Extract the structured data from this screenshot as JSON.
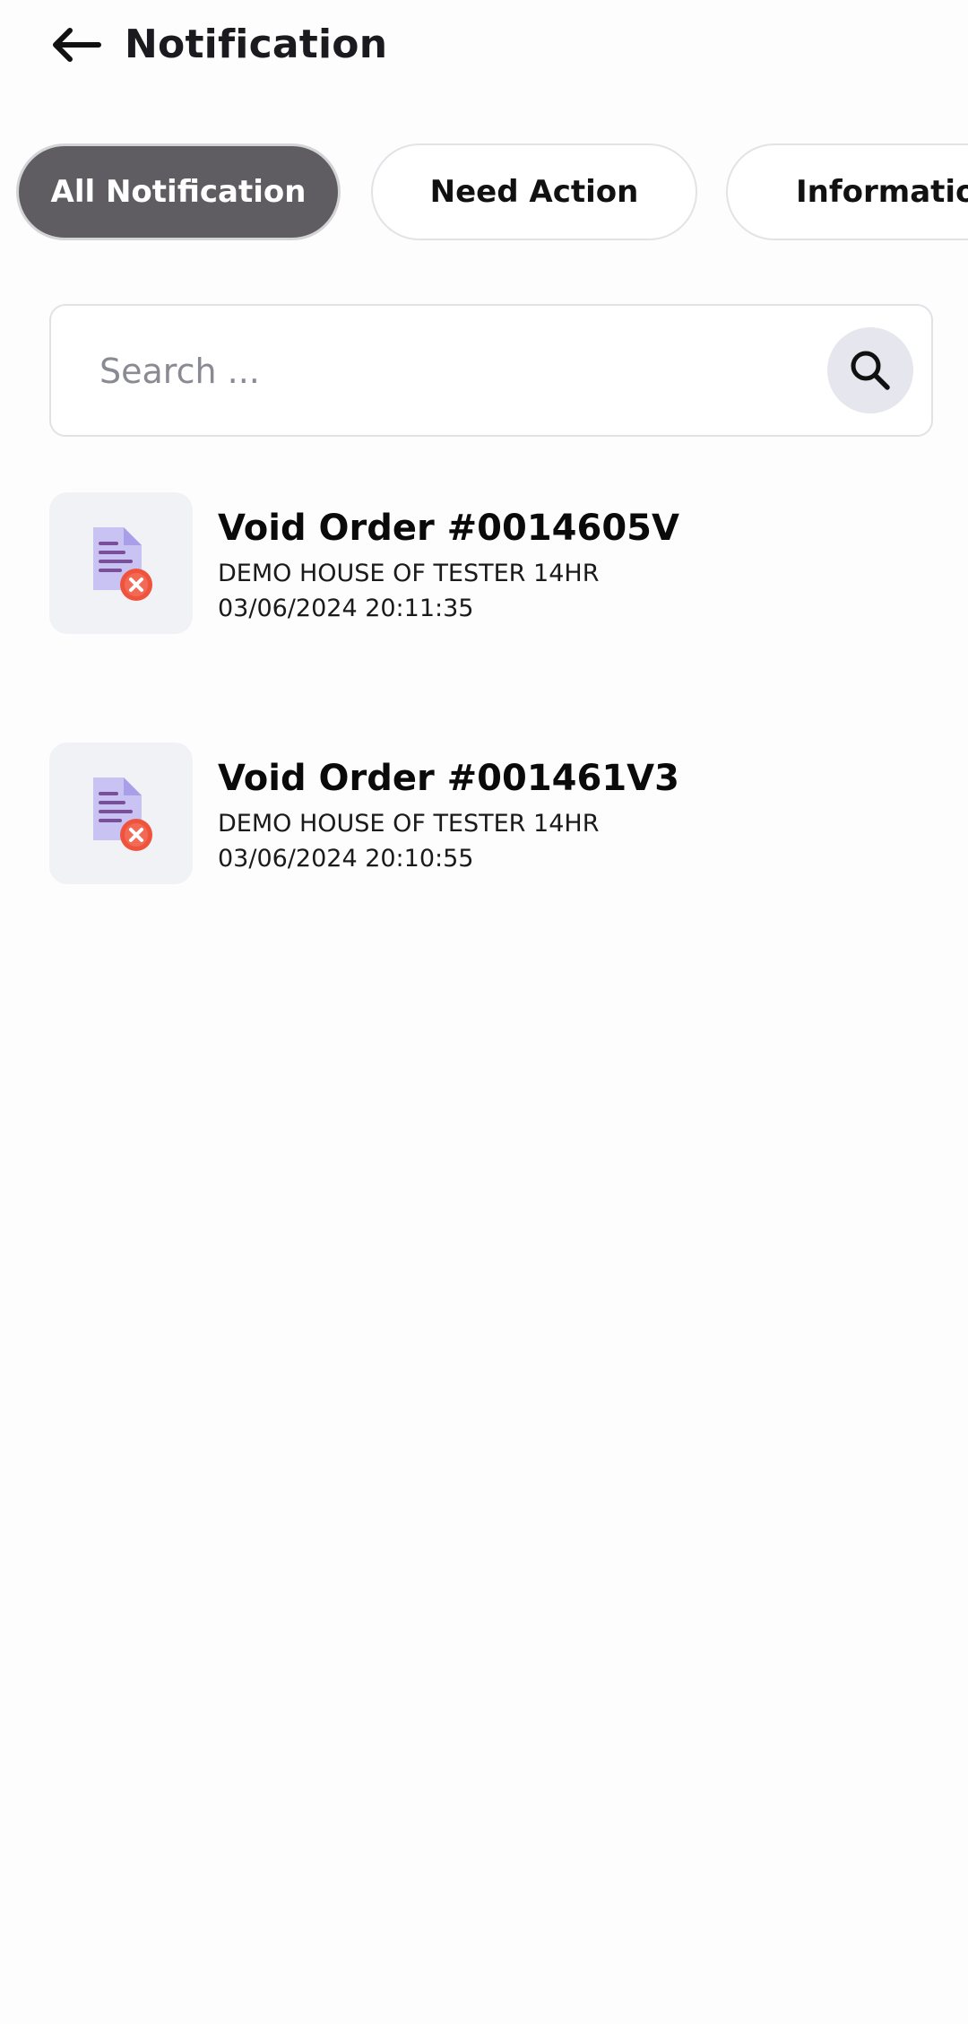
{
  "header": {
    "title": "Notification",
    "back_icon": "arrow-left-icon"
  },
  "tabs": [
    {
      "label": "All Notification",
      "active": true
    },
    {
      "label": "Need Action",
      "active": false
    },
    {
      "label": "Information",
      "active": false
    }
  ],
  "search": {
    "placeholder": "Search ...",
    "value": "",
    "icon": "search-icon"
  },
  "notifications": [
    {
      "title": "Void Order #0014605V",
      "subtitle": "DEMO HOUSE OF TESTER 14HR",
      "timestamp": "03/06/2024 20:11:35",
      "icon": "void-document-icon"
    },
    {
      "title": "Void Order #001461V3",
      "subtitle": "DEMO HOUSE OF TESTER 14HR",
      "timestamp": "03/06/2024 20:10:55",
      "icon": "void-document-icon"
    }
  ],
  "colors": {
    "active_tab_bg": "#5f5d61",
    "search_button_bg": "#e6e7ee",
    "icon_box_bg": "#f1f2f6",
    "void_badge": "#f0533b"
  }
}
